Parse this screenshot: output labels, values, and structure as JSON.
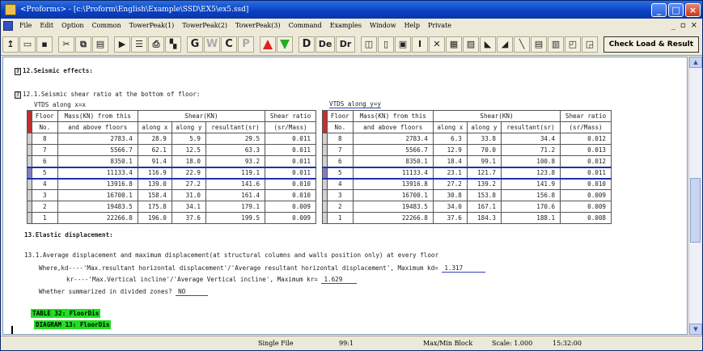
{
  "window": {
    "title": "<Proforms> - [c:\\Proform\\English\\Example\\SSD\\EX5\\ex5.ssd]"
  },
  "menu": [
    "File",
    "Edit",
    "Option",
    "Common",
    "TowerPeak(1)",
    "TowerPeak(2)",
    "TowerPeak(3)",
    "Command",
    "Examples",
    "Window",
    "Help",
    "Private"
  ],
  "toolbar": {
    "g": "G",
    "w": "W",
    "c": "C",
    "p": "P",
    "d": "D",
    "de": "De",
    "dr": "Dr",
    "check": "Check Load & Result"
  },
  "doc": {
    "sec12": "12.Seismic effects:",
    "sec121": "12.1.Seismic shear ratio at the bottom of floor:",
    "vtdsx": "VTDS along x=x",
    "vtdsy": "VTDS along y=y",
    "sec13": "13.Elastic displacement:",
    "sec131": "13.1.Average displacement and maximum displacement(at structural columns and walls position only) at every floor",
    "where1": "Where,kd----'Max.resultant horizontal displacement'/'Average resultant horizontal displacement', Maximum kd=",
    "kdval": "1.317",
    "where2": "kr----'Max.Vertical incline'/'Average Vertical incline', Maximum kr=",
    "krval": "1.629",
    "whether": "Whether summarized in divided zones?",
    "noval": "NO",
    "table32": "TABLE 32: FloorDis",
    "diagram13": "DIAGRAM 13: FloorDis"
  },
  "tableHead": {
    "floor": "Floor",
    "no": "No.",
    "mass1": "Mass(KN) from this",
    "mass2": "and above floors",
    "shear": "Shear(KN)",
    "alongx": "along x",
    "alongy": "along y",
    "result": "resultant(sr)",
    "ratio1": "Shear ratio",
    "ratio2": "(sr/Mass)"
  },
  "tableX": [
    [
      "8",
      "2783.4",
      "28.9",
      "5.9",
      "29.5",
      "0.011"
    ],
    [
      "7",
      "5566.7",
      "62.1",
      "12.5",
      "63.3",
      "0.011"
    ],
    [
      "6",
      "8350.1",
      "91.4",
      "18.0",
      "93.2",
      "0.011"
    ],
    [
      "5",
      "11133.4",
      "116.9",
      "22.9",
      "119.1",
      "0.011"
    ],
    [
      "4",
      "13916.8",
      "139.0",
      "27.2",
      "141.6",
      "0.010"
    ],
    [
      "3",
      "16700.1",
      "158.4",
      "31.0",
      "161.4",
      "0.010"
    ],
    [
      "2",
      "19483.5",
      "175.8",
      "34.1",
      "179.1",
      "0.009"
    ],
    [
      "1",
      "22266.8",
      "196.0",
      "37.6",
      "199.5",
      "0.009"
    ]
  ],
  "tableY": [
    [
      "8",
      "2783.4",
      "6.3",
      "33.8",
      "34.4",
      "0.012"
    ],
    [
      "7",
      "5566.7",
      "12.9",
      "70.0",
      "71.2",
      "0.013"
    ],
    [
      "6",
      "8350.1",
      "18.4",
      "99.1",
      "100.8",
      "0.012"
    ],
    [
      "5",
      "11133.4",
      "23.1",
      "121.7",
      "123.8",
      "0.011"
    ],
    [
      "4",
      "13916.8",
      "27.2",
      "139.2",
      "141.9",
      "0.010"
    ],
    [
      "3",
      "16700.1",
      "30.8",
      "153.8",
      "156.8",
      "0.009"
    ],
    [
      "2",
      "19483.5",
      "34.0",
      "167.1",
      "170.6",
      "0.009"
    ],
    [
      "1",
      "22266.8",
      "37.6",
      "184.3",
      "188.1",
      "0.008"
    ]
  ],
  "status": {
    "file": "Single File",
    "pos": "99:1",
    "mode": "Max/Min Block",
    "scale": "Scale: 1.000",
    "time": "15:32:00"
  }
}
